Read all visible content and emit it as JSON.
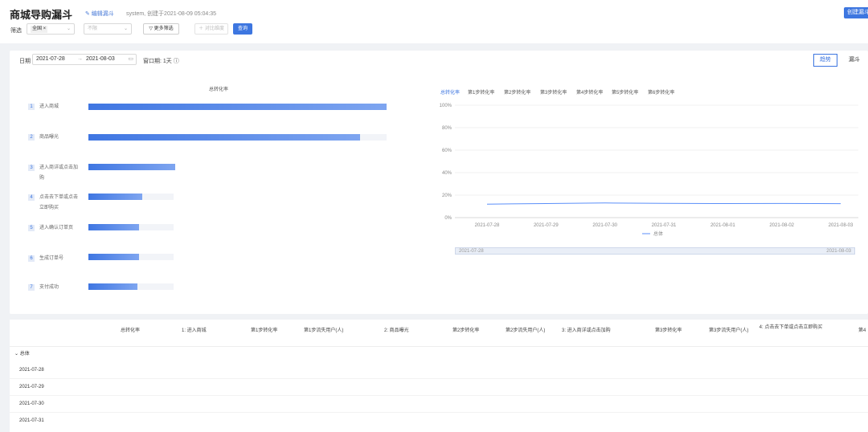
{
  "header": {
    "title": "商城导购漏斗",
    "caret": "▾",
    "edit_label": "✎ 编辑漏斗",
    "meta": "system, 创建于2021-08-09 05:04:35",
    "create_label": "创建漏斗"
  },
  "filters": {
    "label": "筛选",
    "region_tag": "全国 ×",
    "second_placeholder": "不限",
    "more_label": "▽ 更多筛选",
    "compare_label": "＋ 对比维度",
    "query_label": "查询"
  },
  "panel": {
    "date_label": "日期",
    "date_start": "2021-07-28",
    "date_sep": "→",
    "date_end": "2021-08-03",
    "window_label": "窗口期: 1天 ⓘ",
    "tabs": [
      {
        "label": "趋势",
        "active": true
      },
      {
        "label": "漏斗",
        "active": false
      }
    ]
  },
  "funnel": {
    "title": "总转化率",
    "steps": [
      {
        "num": "1",
        "name": "进入商城",
        "value": 1.0
      },
      {
        "num": "2",
        "name": "商品曝光",
        "value": 0.91
      },
      {
        "num": "3",
        "name": "进入商详或点击加购",
        "value": 0.29
      },
      {
        "num": "4",
        "name": "点击去下单或点击立即购买",
        "value": 0.18
      },
      {
        "num": "5",
        "name": "进入确认订单页",
        "value": 0.17
      },
      {
        "num": "6",
        "name": "生成订单号",
        "value": 0.17
      },
      {
        "num": "7",
        "name": "支付成功",
        "value": 0.165
      }
    ]
  },
  "chart_legend": [
    "总转化率",
    "第1步转化率",
    "第2步转化率",
    "第3步转化率",
    "第4步转化率",
    "第5步转化率",
    "第6步转化率"
  ],
  "chart_data": {
    "type": "line",
    "x": [
      "2021-07-28",
      "2021-07-29",
      "2021-07-30",
      "2021-07-31",
      "2021-08-01",
      "2021-08-02",
      "2021-08-03"
    ],
    "series": [
      {
        "name": "总体",
        "values": [
          12,
          12.5,
          13,
          12.7,
          12.5,
          12.6,
          12.4
        ],
        "color": "#5b8ff9"
      }
    ],
    "yticks": [
      "100%",
      "80%",
      "60%",
      "40%",
      "20%",
      "0%"
    ],
    "ylim": [
      0,
      100
    ],
    "grid": true,
    "legend": "bottom-center",
    "slider_start": "2021-07-28",
    "slider_end": "2021-08-03"
  },
  "table": {
    "headers": [
      "总转化率",
      "1: 进入商城",
      "第1步转化率",
      "第1步流失用户(人)",
      "2: 商品曝光",
      "第2步转化率",
      "第2步流失用户(人)",
      "3: 进入商详或点击加购",
      "第3步转化率",
      "第3步流失用户(人)",
      "4: 点击去下单或点击立即购买",
      "第4"
    ],
    "group_label": "⌄ 总体",
    "rows": [
      "2021-07-28",
      "2021-07-29",
      "2021-07-30",
      "2021-07-31"
    ]
  }
}
